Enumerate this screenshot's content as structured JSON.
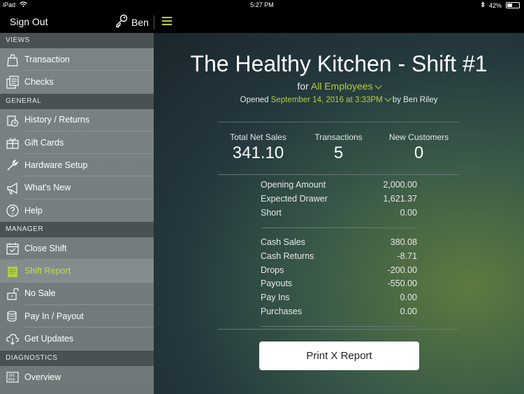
{
  "status": {
    "device": "iPad",
    "time": "5:27 PM",
    "battery": "42%",
    "battery_level": 0.42
  },
  "topbar": {
    "sign_out": "Sign Out",
    "user": "Ben"
  },
  "sidebar": {
    "sections": [
      {
        "title": "VIEWS",
        "items": [
          {
            "label": "Transaction",
            "icon": "shopping-bag-icon"
          },
          {
            "label": "Checks",
            "icon": "receipts-icon"
          }
        ]
      },
      {
        "title": "GENERAL",
        "items": [
          {
            "label": "History / Returns",
            "icon": "history-icon"
          },
          {
            "label": "Gift Cards",
            "icon": "gift-card-icon"
          },
          {
            "label": "Hardware Setup",
            "icon": "wrench-icon"
          },
          {
            "label": "What's New",
            "icon": "megaphone-icon"
          },
          {
            "label": "Help",
            "icon": "help-icon"
          }
        ]
      },
      {
        "title": "MANAGER",
        "items": [
          {
            "label": "Close Shift",
            "icon": "calendar-check-icon"
          },
          {
            "label": "Shift Report",
            "icon": "report-icon",
            "active": true
          },
          {
            "label": "No Sale",
            "icon": "unlock-icon"
          },
          {
            "label": "Pay In / Payout",
            "icon": "coins-icon"
          },
          {
            "label": "Get Updates",
            "icon": "cloud-download-icon"
          }
        ]
      },
      {
        "title": "DIAGNOSTICS",
        "items": [
          {
            "label": "Overview",
            "icon": "binary-icon"
          }
        ]
      }
    ]
  },
  "report": {
    "title": "The Healthy Kitchen - Shift #1",
    "for_prefix": "for",
    "for_value": "All Employees",
    "opened_prefix": "Opened",
    "opened_value": "September 14, 2016 at 3:33PM",
    "opened_by": "by Ben Riley",
    "stats": [
      {
        "label": "Total Net Sales",
        "value": "341.10"
      },
      {
        "label": "Transactions",
        "value": "5"
      },
      {
        "label": "New Customers",
        "value": "0"
      }
    ],
    "drawer": [
      {
        "label": "Opening Amount",
        "value": "2,000.00"
      },
      {
        "label": "Expected Drawer",
        "value": "1,621.37"
      },
      {
        "label": "Short",
        "value": "0.00"
      }
    ],
    "cash": [
      {
        "label": "Cash Sales",
        "value": "380.08"
      },
      {
        "label": "Cash Returns",
        "value": "-8.71"
      },
      {
        "label": "Drops",
        "value": "-200.00"
      },
      {
        "label": "Payouts",
        "value": "-550.00"
      },
      {
        "label": "Pay Ins",
        "value": "0.00"
      },
      {
        "label": "Purchases",
        "value": "0.00"
      }
    ],
    "print_button": "Print X Report"
  },
  "colors": {
    "accent": "#b8cf3a",
    "sidebar": "#7c8485",
    "section": "#4a5152"
  }
}
